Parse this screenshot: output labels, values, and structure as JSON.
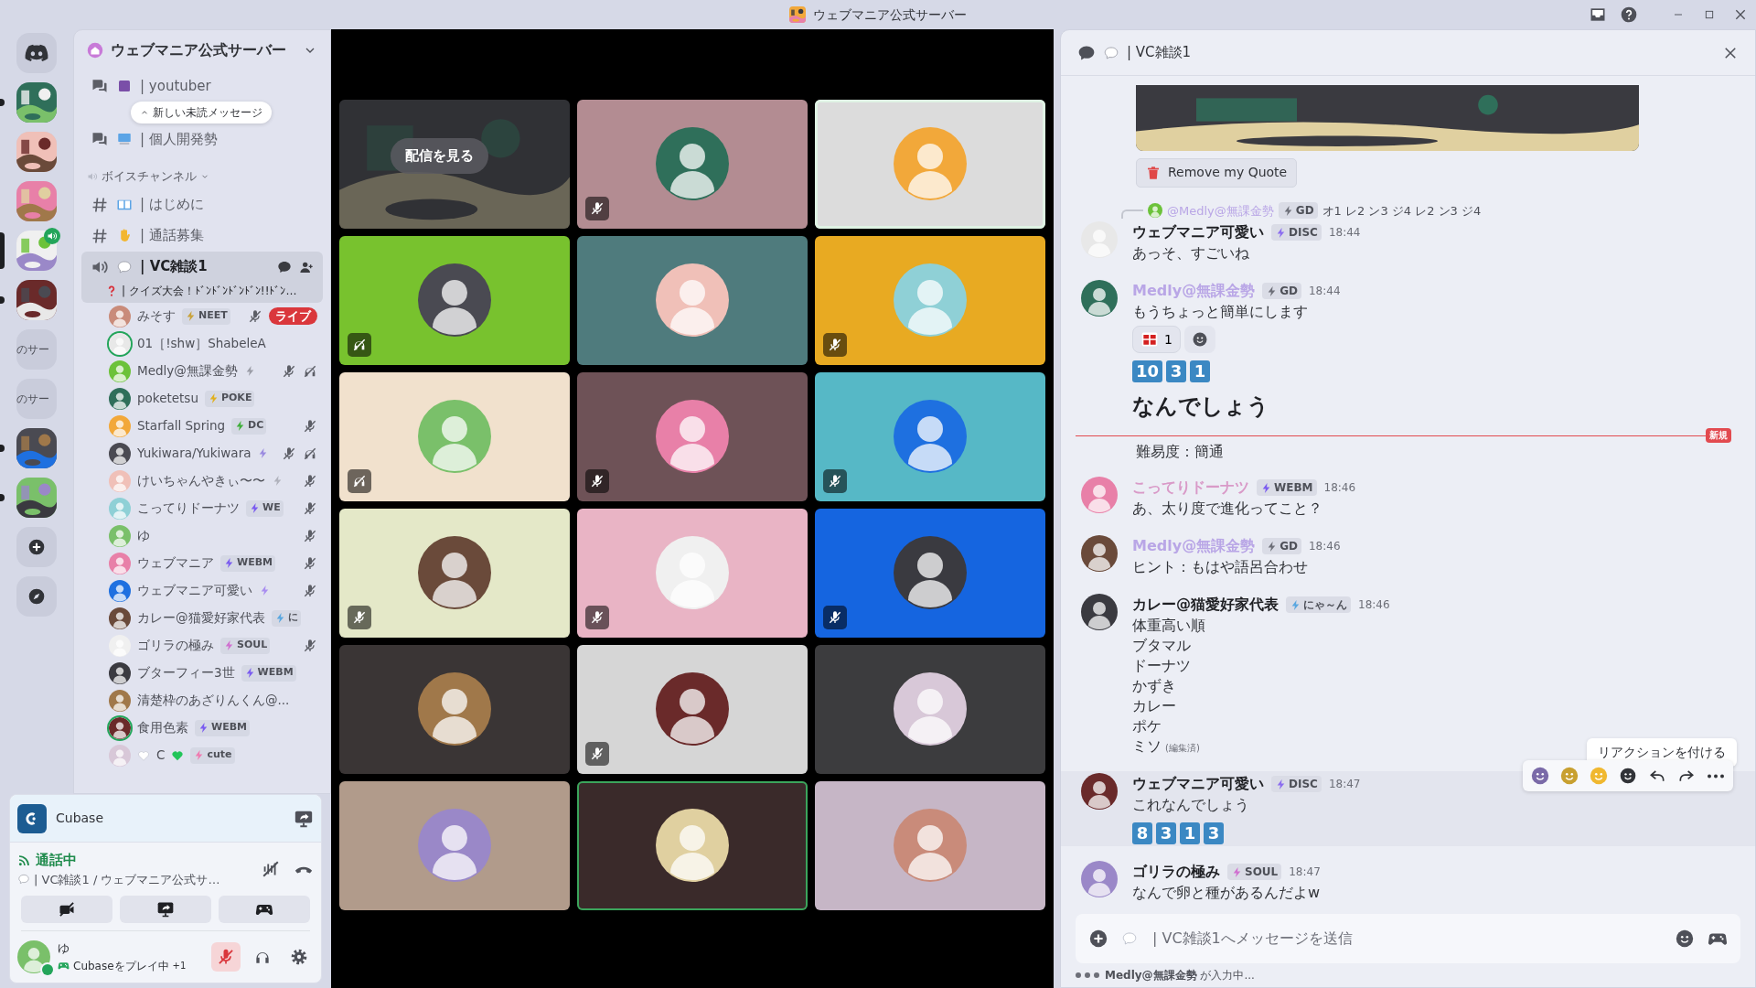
{
  "title_bar": {
    "title": "ウェブマニア公式サーバー"
  },
  "servers": [
    {
      "kind": "home",
      "selected": false,
      "unread": false
    },
    {
      "kind": "picture",
      "selected": false,
      "unread": true
    },
    {
      "kind": "picture",
      "selected": false,
      "unread": false
    },
    {
      "kind": "picture",
      "selected": false,
      "unread": false
    },
    {
      "kind": "picture",
      "selected": true,
      "unread": false,
      "in_voice": true
    },
    {
      "kind": "picture",
      "selected": false,
      "unread": true
    },
    {
      "kind": "text",
      "text": "のサー",
      "selected": false,
      "unread": false
    },
    {
      "kind": "text",
      "text": "のサー",
      "selected": false,
      "unread": false
    },
    {
      "kind": "picture",
      "selected": false,
      "unread": true
    },
    {
      "kind": "picture",
      "selected": false,
      "unread": true
    },
    {
      "kind": "add",
      "selected": false,
      "unread": false
    },
    {
      "kind": "explore",
      "selected": false,
      "unread": false
    }
  ],
  "server_header": {
    "name": "ウェブマニア公式サーバー"
  },
  "unread_notice": "新しい未読メッセージ",
  "channels": [
    {
      "kind": "forum",
      "name": "| youtuber",
      "selected": false
    },
    {
      "kind": "forum",
      "name": "| 個人開発勢",
      "selected": false
    },
    {
      "kind": "category",
      "name": "ボイスチャンネル",
      "selected": false
    },
    {
      "kind": "text",
      "name": "| はじめに",
      "selected": false
    },
    {
      "kind": "text",
      "name": "| 通話募集",
      "selected": false
    },
    {
      "kind": "voice",
      "name": "| VC雑談1",
      "status": "| クイズ大会！ﾄﾞﾝﾄﾞﾝﾄﾞﾝﾄﾞﾝ!!ﾄﾞﾝ…",
      "selected": true
    }
  ],
  "members": [
    {
      "name": "みそす",
      "tag": {
        "text": "NEET",
        "color": "#c9a23a"
      },
      "muted": true,
      "deafened": false,
      "live": "ライブ",
      "speaking": false
    },
    {
      "name": "01［!shw］ShabeleA",
      "muted": false,
      "deafened": false,
      "speaking": true
    },
    {
      "name": "Medly@無課金勢",
      "tag": {
        "color": "#9a9ca6"
      },
      "muted": true,
      "deafened": true,
      "speaking": false
    },
    {
      "name": "poketetsu",
      "tag": {
        "text": "POKE",
        "color": "#e0b020"
      },
      "muted": false,
      "deafened": false,
      "speaking": false
    },
    {
      "name": "Starfall Spring",
      "tag": {
        "text": "DC",
        "color": "#3fae3a"
      },
      "muted": true,
      "deafened": false,
      "speaking": false
    },
    {
      "name": "Yukiwara/Yukiwara",
      "tag": {
        "color": "#9a8ae0"
      },
      "muted": true,
      "deafened": true,
      "speaking": false
    },
    {
      "name": "けいちゃんやきぃ〜〜",
      "tag": {
        "color": "#b0b2bc"
      },
      "muted": true,
      "deafened": false,
      "speaking": false
    },
    {
      "name": "こってりドーナツ",
      "tag": {
        "text": "WE",
        "color": "#7b5cf0"
      },
      "muted": true,
      "deafened": false,
      "speaking": false
    },
    {
      "name": "ゆ",
      "muted": true,
      "deafened": false,
      "speaking": false
    },
    {
      "name": "ウェブマニア",
      "tag": {
        "text": "WEBM",
        "color": "#7b5cf0"
      },
      "muted": true,
      "deafened": false,
      "speaking": false
    },
    {
      "name": "ウェブマニア可愛い",
      "tag": {
        "color": "#a98ef0"
      },
      "muted": true,
      "deafened": false,
      "speaking": false
    },
    {
      "name": "カレー@猫愛好家代表",
      "tag": {
        "text": "に",
        "color": "#5aa7e0"
      },
      "muted": false,
      "deafened": false,
      "speaking": false
    },
    {
      "name": "ゴリラの極み",
      "tag": {
        "text": "SOUL",
        "color": "#d070d0"
      },
      "muted": true,
      "deafened": false,
      "speaking": false
    },
    {
      "name": "ブターフィー3世",
      "tag": {
        "text": "WEBM",
        "color": "#7b5cf0"
      },
      "muted": false,
      "deafened": false,
      "speaking": false
    },
    {
      "name": "清楚枠のあざりんくん@...",
      "muted": false,
      "deafened": false,
      "speaking": false
    },
    {
      "name": "食用色素",
      "tag": {
        "text": "WEBM",
        "color": "#7b5cf0"
      },
      "muted": false,
      "deafened": false,
      "speaking": true
    },
    {
      "name": "C",
      "hearts": true,
      "tag": {
        "text": "cute",
        "color": "#f07ab0"
      },
      "muted": false,
      "deafened": false,
      "speaking": false
    }
  ],
  "activity": {
    "name": "Cubase"
  },
  "call": {
    "status": "通話中",
    "channel": "| VC雑談1 / ウェブマニア公式サ…"
  },
  "user": {
    "name": "ゆ",
    "activity": "Cubaseをプレイ中",
    "extra": "+1",
    "muted": true
  },
  "tiles": [
    {
      "kind": "stream",
      "label": "配信を見る",
      "color": "#2b2d31",
      "muted": false,
      "deafened": false,
      "speaking": false
    },
    {
      "kind": "user",
      "color": "#b38c92",
      "muted": true,
      "deafened": false,
      "speaking": false
    },
    {
      "kind": "user",
      "color": "#dcdcdc",
      "muted": false,
      "deafened": false,
      "speaking": true
    },
    {
      "kind": "user",
      "color": "#78c22e",
      "muted": false,
      "deafened": true,
      "speaking": false
    },
    {
      "kind": "user",
      "color": "#4f7b7d",
      "muted": false,
      "deafened": false,
      "speaking": false
    },
    {
      "kind": "user",
      "color": "#e8aa22",
      "muted": true,
      "deafened": false,
      "speaking": false
    },
    {
      "kind": "user",
      "color": "#f1e1cd",
      "muted": false,
      "deafened": true,
      "speaking": false
    },
    {
      "kind": "user",
      "color": "#6e5257",
      "muted": true,
      "deafened": false,
      "speaking": false
    },
    {
      "kind": "user",
      "color": "#56b8c6",
      "muted": true,
      "deafened": false,
      "speaking": false
    },
    {
      "kind": "user",
      "color": "#e4e8c8",
      "muted": true,
      "deafened": false,
      "speaking": false
    },
    {
      "kind": "user",
      "color": "#e9b4c5",
      "muted": true,
      "deafened": false,
      "speaking": false
    },
    {
      "kind": "user",
      "color": "#1565e0",
      "muted": true,
      "deafened": false,
      "speaking": false
    },
    {
      "kind": "user",
      "color": "#3a3535",
      "muted": false,
      "deafened": false,
      "speaking": false
    },
    {
      "kind": "user",
      "color": "#d6d6d6",
      "muted": true,
      "deafened": false,
      "speaking": false
    },
    {
      "kind": "user",
      "color": "#3c3c3e",
      "muted": false,
      "deafened": false,
      "speaking": false
    },
    {
      "kind": "user",
      "color": "#b19b8b",
      "muted": false,
      "deafened": false,
      "speaking": false
    },
    {
      "kind": "user",
      "color": "#3a2a2a",
      "muted": false,
      "deafened": false,
      "speaking": true
    },
    {
      "kind": "user",
      "color": "#c6b6c6",
      "muted": false,
      "deafened": false,
      "speaking": false
    }
  ],
  "chat": {
    "title": "| VC雑談1",
    "quote_button": "Remove my Quote",
    "messages": [
      {
        "kind": "message",
        "reply": {
          "author": "@Medly@無課金勢",
          "color": "#b9a6e6",
          "tag": {
            "text": "GD",
            "color": "#6d6f78"
          },
          "text": "オ1 レ2 ン3 ジ4 レ2 ン3 ジ4"
        },
        "author": "ウェブマニア可愛い",
        "tag": {
          "text": "DISC",
          "color": "#8b6cf0"
        },
        "time": "18:44",
        "lines": [
          "あっそ、すごいね"
        ],
        "hovered": false
      },
      {
        "kind": "message",
        "author": "Medly@無課金勢",
        "color": "#b9a6e6",
        "tag": {
          "text": "GD",
          "color": "#6d6f78"
        },
        "time": "18:44",
        "lines": [
          "もうちょっと簡単にします"
        ],
        "reactions": [
          {
            "count": "1",
            "selected": false
          }
        ],
        "keycaps": [
          "10",
          "3",
          "1"
        ],
        "heading": "なんでしょう",
        "hovered": false
      },
      {
        "kind": "new-divider",
        "label": "新規"
      },
      {
        "kind": "continuation",
        "lines": [
          "難易度：簡通"
        ]
      },
      {
        "kind": "message",
        "author": "こってりドーナツ",
        "color": "#d99ac8",
        "tag": {
          "text": "WEBM",
          "color": "#7b5cf0"
        },
        "time": "18:46",
        "lines": [
          "あ、太り度で進化ってこと？"
        ],
        "hovered": false
      },
      {
        "kind": "message",
        "author": "Medly@無課金勢",
        "color": "#b9a6e6",
        "tag": {
          "text": "GD",
          "color": "#6d6f78"
        },
        "time": "18:46",
        "lines": [
          "ヒント：もはや語呂合わせ"
        ],
        "hovered": false
      },
      {
        "kind": "message",
        "author": "カレー@猫愛好家代表",
        "tag": {
          "text": "にゃ～ん",
          "color": "#5aa7e0"
        },
        "time": "18:46",
        "lines": [
          "体重高い順",
          "ブタマル",
          "ドーナツ",
          "かずき",
          "カレー",
          "ポケ",
          "ミソ"
        ],
        "edited": "(編集済)",
        "hovered": false
      },
      {
        "kind": "message",
        "author": "ウェブマニア可愛い",
        "tag": {
          "text": "DISC",
          "color": "#8b6cf0"
        },
        "time": "18:47",
        "lines": [
          "これなんでしょう"
        ],
        "keycaps": [
          "8",
          "3",
          "1",
          "3"
        ],
        "hovered": true
      },
      {
        "kind": "message",
        "author": "ゴリラの極み",
        "tag": {
          "text": "SOUL",
          "color": "#d070d0"
        },
        "time": "18:47",
        "lines": [
          "なんで卵と種があるんだよw"
        ],
        "hovered": false
      }
    ],
    "hover_tooltip": "リアクションを付ける",
    "placeholder": "| VC雑談1へメッセージを送信",
    "typing_user": "Medly@無課金勢",
    "typing_text": "が入力中..."
  }
}
